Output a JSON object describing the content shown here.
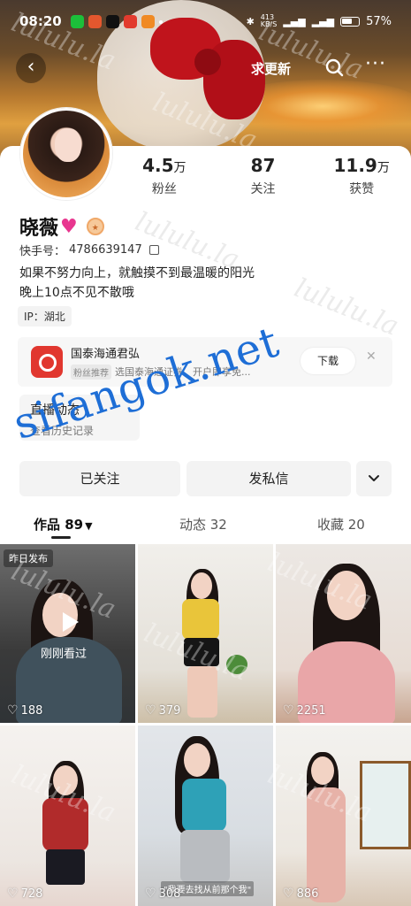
{
  "status_bar": {
    "time": "08:20",
    "network_speed": "413\nKB/S",
    "battery": "57%"
  },
  "nav": {
    "update_label": "求更新"
  },
  "profile": {
    "name": "晓薇",
    "kuaishou_id_label": "快手号：",
    "kuaishou_id": "4786639147",
    "bio_line1": "如果不努力向上，就触摸不到最温暖的阳光",
    "bio_line2": "晚上10点不见不散哦",
    "ip": "IP：湖北"
  },
  "stats": [
    {
      "num": "4.5",
      "unit": "万",
      "label": "粉丝"
    },
    {
      "num": "87",
      "unit": "",
      "label": "关注"
    },
    {
      "num": "11.9",
      "unit": "万",
      "label": "获赞"
    }
  ],
  "ad": {
    "title": "国泰海通君弘",
    "tag": "粉丝推荐",
    "desc": "选国泰海通证券，开户即享免...",
    "download": "下载",
    "close": "✕"
  },
  "live": {
    "title": "直播动态",
    "subtitle": "查看历史记录"
  },
  "actions": {
    "follow": "已关注",
    "message": "发私信"
  },
  "tabs": {
    "works": "作品 89",
    "dynamics": "动态 32",
    "favorites": "收藏 20"
  },
  "grid": [
    {
      "likes": "188",
      "pin": "昨日发布",
      "watched": "刚刚看过"
    },
    {
      "likes": "379"
    },
    {
      "likes": "2251"
    },
    {
      "likes": "728"
    },
    {
      "likes": "308",
      "subtitle": "\"我要去找从前那个我\""
    },
    {
      "likes": "886"
    }
  ],
  "watermarks": {
    "text": "lululu.la",
    "overlay": "sifangok.net"
  },
  "colors": {
    "accent_heart": "#e8368f",
    "overlay_blue": "#1e6ed6",
    "ad_logo": "#e1372f"
  }
}
